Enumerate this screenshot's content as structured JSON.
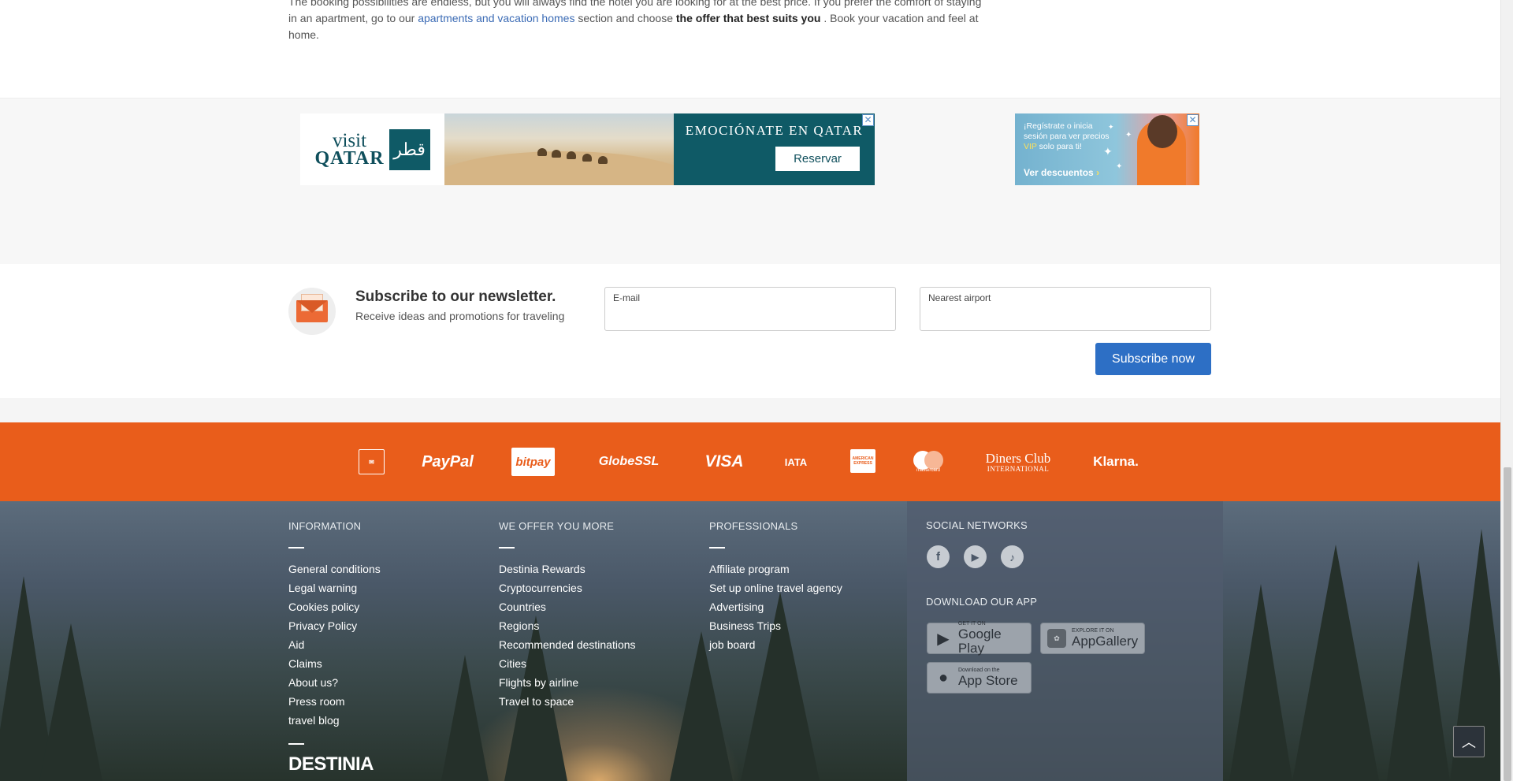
{
  "intro": {
    "line1": "The booking possibilities are endless, but you will always find the hotel you are looking for at the best price. If you prefer the comfort of staying",
    "line2_a": "in an apartment, go to our ",
    "line2_link": "apartments and vacation homes",
    "line2_b": " section and choose ",
    "line2_bold": "the offer that best suits you",
    "line2_c": " . Book your vacation and feel at",
    "line3": "home."
  },
  "ads": {
    "qatar": {
      "logo_visit": "visit",
      "logo_qatar": "QATAR",
      "emblem": "قطر",
      "headline": "EMOCIÓNATE EN QATAR",
      "button": "Reservar",
      "close": "✕"
    },
    "vip": {
      "text_a": "¡Regístrate o inicia sesión para ver precios ",
      "text_vip": "VIP",
      "text_b": " solo para ti!",
      "link": "Ver descuentos",
      "arrow": "›",
      "close": "✕"
    }
  },
  "newsletter": {
    "title": "Subscribe to our newsletter.",
    "subtitle": "Receive ideas and promotions for traveling",
    "email_label": "E-mail",
    "email_value": "",
    "airport_label": "Nearest airport",
    "airport_value": "",
    "button": "Subscribe now"
  },
  "payments": {
    "paypal": "PayPal",
    "bitpay": "bitpay",
    "globessl": "GlobeSSL",
    "visa": "VISA",
    "iata": "IATA",
    "amex": "AMERICAN EXPRESS",
    "mastercard": "mastercard",
    "diners_line1": "Diners Club",
    "diners_line2": "INTERNATIONAL",
    "klarna": "Klarna."
  },
  "footer": {
    "information": {
      "heading": "INFORMATION",
      "links": [
        "General conditions",
        "Legal warning",
        "Cookies policy",
        "Privacy Policy",
        "Aid",
        "Claims",
        "About us?",
        "Press room",
        "travel blog"
      ]
    },
    "more": {
      "heading": "WE OFFER YOU MORE",
      "links": [
        "Destinia Rewards",
        "Cryptocurrencies",
        "Countries",
        "Regions",
        "Recommended destinations",
        "Cities",
        "Flights by airline",
        "Travel to space"
      ]
    },
    "professionals": {
      "heading": "PROFESSIONALS",
      "links": [
        "Affiliate program",
        "Set up online travel agency",
        "Advertising",
        "Business Trips",
        "job board"
      ]
    },
    "social_heading": "SOCIAL NETWORKS",
    "app_heading": "DOWNLOAD OUR APP",
    "apps": {
      "google_small": "GET IT ON",
      "google_big": "Google Play",
      "huawei_small": "EXPLORE IT ON",
      "huawei_big": "AppGallery",
      "apple_small": "Download on the",
      "apple_big": "App Store"
    },
    "brand": "DESTINIA",
    "back_to_top": "︿"
  }
}
